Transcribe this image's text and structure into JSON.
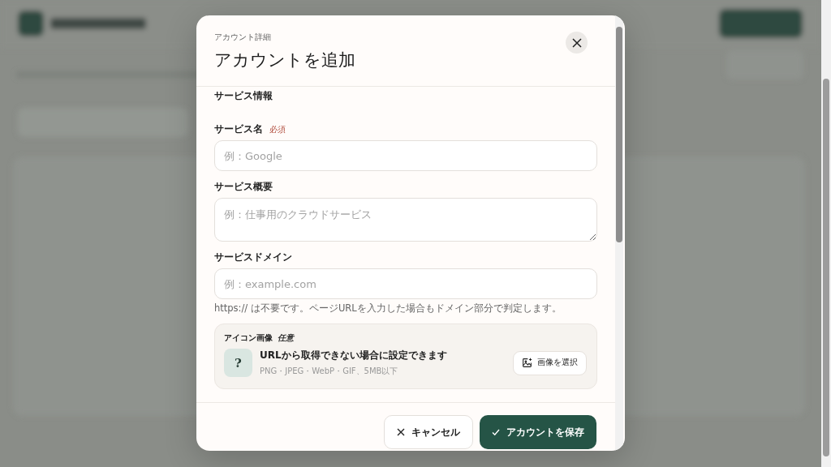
{
  "dialog": {
    "eyebrow": "アカウント詳細",
    "title": "アカウントを追加",
    "section_title": "サービス情報",
    "fields": [
      {
        "kind": "input",
        "label": "サービス名",
        "required_badge": "必須",
        "placeholder": "例：Google"
      },
      {
        "kind": "textarea",
        "label": "サービス概要",
        "placeholder": "例：仕事用のクラウドサービス"
      },
      {
        "kind": "input",
        "label": "サービスドメイン",
        "placeholder": "例：example.com",
        "hint": "https:// は不要です。ページURLを入力した場合もドメイン部分で判定します。"
      }
    ],
    "icon_image": {
      "label": "アイコン画像",
      "optional_tag": "任意",
      "placeholder_glyph": "?",
      "description": "URLから取得できない場合に設定できます",
      "formats": "PNG・JPEG・WebP・GIF、5MB以下",
      "button": "画像を選択"
    },
    "buttons": [
      {
        "kind": "cancel",
        "label": "キャンセル"
      },
      {
        "kind": "save",
        "label": "アカウントを保存"
      }
    ]
  }
}
